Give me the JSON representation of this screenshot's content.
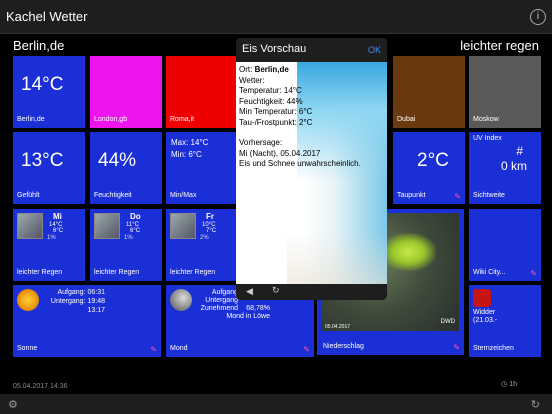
{
  "app": {
    "title": "Kachel Wetter",
    "info_icon": "info-icon"
  },
  "header": {
    "city": "Berlin,de",
    "condition": "leichter regen"
  },
  "tiles": {
    "temp": {
      "value": "14°C",
      "label": "Berlin,de"
    },
    "london": {
      "label": "London,gb"
    },
    "rome": {
      "label": "Roma,it"
    },
    "dubai": {
      "label": "Dubai"
    },
    "moscow": {
      "label": "Moskow"
    },
    "feels": {
      "value": "13°C",
      "label": "Gefühlt"
    },
    "humidity": {
      "value": "44%",
      "label": "Feuchtigkeit"
    },
    "minmax": {
      "max": "Max: 14°C",
      "min": "Min: 6°C",
      "label": "Min/Max"
    },
    "dew": {
      "value": "2°C",
      "label": "Taupunkt"
    },
    "uv": {
      "title": "UV Index",
      "value": "#",
      "vis": "0 km",
      "label": "Sichtweite"
    },
    "day1": {
      "name": "Mi",
      "max": "14°C",
      "min": "6°C",
      "precip": "1%",
      "label": "leichter Regen"
    },
    "day2": {
      "name": "Do",
      "max": "11°C",
      "min": "6°C",
      "precip": "1%",
      "label": "leichter Regen"
    },
    "day3": {
      "name": "Fr",
      "max": "10°C",
      "min": "7°C",
      "precip": "2%",
      "label": "leichter Regen"
    },
    "wiki": {
      "label": "Wiki City..."
    },
    "sun": {
      "rise": "Aufgang: 06:31",
      "set": "Untergang: 19:48",
      "length": "13:17",
      "label": "Sonne"
    },
    "moon": {
      "rise": "Aufgang",
      "set": "Untergang",
      "phase_pct": "68,78%",
      "phase": "Zunehmend",
      "sign": "Mond in Löwe",
      "label": "Mond"
    },
    "radar": {
      "label": "Niederschlag",
      "logo": "DWD",
      "date": "05.04.2017"
    },
    "zodiac": {
      "name": "Widder",
      "date": "(21.03.-",
      "label": "Sternzeichen"
    }
  },
  "popup": {
    "title": "Eis Vorschau",
    "ok": "OK",
    "ort_label": "Ort: ",
    "ort_value": "Berlin,de",
    "lines": [
      "Wetter:",
      "Temperatur: 14°C",
      "Feuchtigkeit: 44%",
      "Min Temperatur: 6°C",
      "Tau-/Frostpunkt: 2°C"
    ],
    "forecast_title": "Vorhersage:",
    "forecast_lines": [
      "Mi (Nacht), 05.04.2017",
      "Eis und Schnee unwahrscheinlich."
    ],
    "back_icon": "back-arrow-icon",
    "reload_icon": "reload-icon"
  },
  "footer": {
    "time": "05.04.2017 14:36",
    "sync": "1h"
  }
}
